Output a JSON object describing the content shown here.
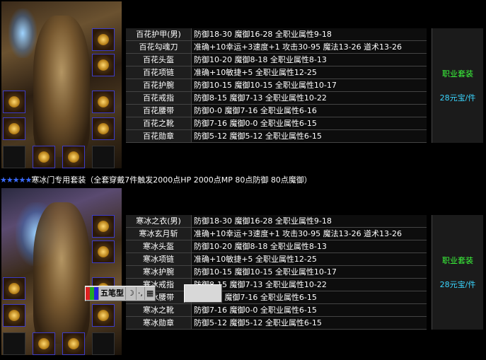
{
  "set1": {
    "items": [
      {
        "name": "百花护甲(男)",
        "attrs": "防御18-30 魔御16-28 全职业属性9-18"
      },
      {
        "name": "百花勾魂刀",
        "attrs": "准确+10幸运+3速度+1    攻击30-95 魔法13-26 道术13-26"
      },
      {
        "name": "百花头盔",
        "attrs": "防御10-20 魔御8-18 全职业属性8-13"
      },
      {
        "name": "百花项链",
        "attrs": "准确+10敏捷+5 全职业属性12-25"
      },
      {
        "name": "百花护腕",
        "attrs": "防御10-15 魔御10-15  全职业属性10-17"
      },
      {
        "name": "百花戒指",
        "attrs": "防御8-15 魔御7-13 全职业属性10-22"
      },
      {
        "name": "百花腰带",
        "attrs": "防御0-0 魔御7-16 全职业属性6-16"
      },
      {
        "name": "百花之靴",
        "attrs": "防御7-16 魔御0-0 全职业属性6-15"
      },
      {
        "name": "百花勋章",
        "attrs": "防御5-12 魔御5-12 全职业属性6-15"
      }
    ],
    "class_label": "职业套装",
    "price": "28元宝/件"
  },
  "banner": {
    "stars": "★★★★★",
    "text": "寒冰门专用套装（全套穿戴7件触发2000点HP 2000点MP 80点防御 80点魔御）"
  },
  "set2": {
    "items": [
      {
        "name": "寒冰之衣(男)",
        "attrs": "防御18-30 魔御16-28 全职业属性9-18"
      },
      {
        "name": "寒冰玄月斩",
        "attrs": "准确+10幸运+3速度+1    攻击30-95 魔法13-26 道术13-26"
      },
      {
        "name": "寒冰头盔",
        "attrs": "防御10-20 魔御8-18 全职业属性8-13"
      },
      {
        "name": "寒冰项链",
        "attrs": "准确+10敏捷+5 全职业属性12-25"
      },
      {
        "name": "寒冰护腕",
        "attrs": "防御10-15 魔御10-15  全职业属性10-17"
      },
      {
        "name": "寒冰戒指",
        "attrs": "防御8-15 魔御7-13 全职业属性10-22"
      },
      {
        "name": "寒冰腰带",
        "attrs": "防御0-0 魔御7-16 全职业属性6-15"
      },
      {
        "name": "寒冰之靴",
        "attrs": "防御7-16 魔御0-0 全职业属性6-15"
      },
      {
        "name": "寒冰勋章",
        "attrs": "防御5-12 魔御5-12 全职业属性6-15"
      }
    ],
    "class_label": "职业套装",
    "price": "28元宝/件"
  },
  "ime": {
    "mode": "五笔型",
    "moon": "☽",
    "punct": "·,",
    "keyboard": "▦"
  },
  "colors": {
    "name_bg": "#1e1e1e",
    "class_text": "#3cff3c",
    "price_text": "#3ad6ff",
    "star": "#3a6bff"
  }
}
